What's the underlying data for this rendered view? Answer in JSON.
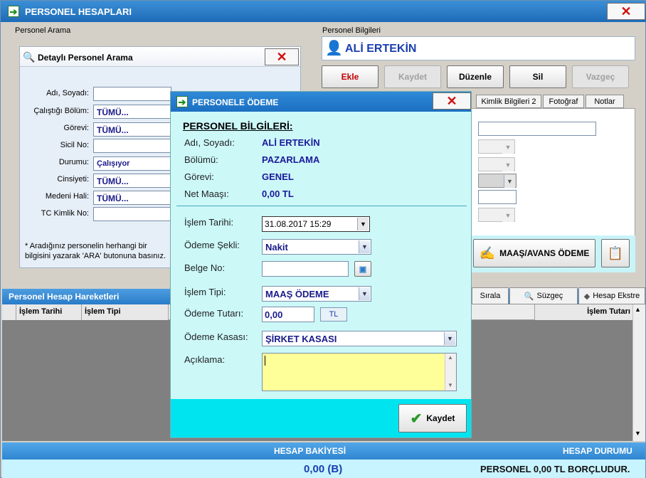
{
  "window": {
    "title": "PERSONEL HESAPLARI"
  },
  "search_panel": {
    "group_label": "Personel Arama",
    "title": "Detaylı Personel Arama",
    "fields": {
      "ad_soyad": {
        "label": "Adı, Soyadı:",
        "value": ""
      },
      "bolum": {
        "label": "Çalıştığı Bölüm:",
        "value": "TÜMÜ..."
      },
      "gorev": {
        "label": "Görevi:",
        "value": "TÜMÜ..."
      },
      "sicil": {
        "label": "Sicil No:",
        "value": ""
      },
      "durum": {
        "label": "Durumu:",
        "value": "Çalışıyor"
      },
      "cinsiyet": {
        "label": "Cinsiyeti:",
        "value": "TÜMÜ..."
      },
      "medeni": {
        "label": "Medeni Hali:",
        "value": "TÜMÜ..."
      },
      "tc": {
        "label": "TC Kimlik No:",
        "value": ""
      }
    },
    "hint": "* Aradığınız personelin herhangi bir bilgisini yazarak 'ARA' butonuna basınız."
  },
  "personel_info": {
    "group_label": "Personel Bilgileri",
    "name": "ALİ ERTEKİN",
    "buttons": {
      "ekle": "Ekle",
      "kaydet": "Kaydet",
      "duzenle": "Düzenle",
      "sil": "Sil",
      "vazgec": "Vazgeç"
    },
    "tabs": [
      "Kimlik Bilgileri 2",
      "Fotoğraf",
      "Notlar"
    ],
    "maas_button": "MAAŞ/AVANS ÖDEME"
  },
  "hareketler": {
    "title": "Personel Hesap Hareketleri",
    "toolbar": {
      "sirala": "Sırala",
      "suzgec": "Süzgeç",
      "ekstre": "Hesap Ekstre"
    },
    "columns": {
      "tarih": "İşlem Tarihi",
      "tip": "İşlem Tipi",
      "tutar": "İşlem Tutarı"
    }
  },
  "footer": {
    "bakiye_label": "HESAP BAKİYESİ",
    "durum_label": "HESAP DURUMU",
    "bakiye_value": "0,00 (B)",
    "durum_value": "PERSONEL 0,00 TL BORÇLUDUR."
  },
  "dialog": {
    "title": "PERSONELE ÖDEME",
    "section": "PERSONEL BİLGİLERİ:",
    "info": {
      "ad_label": "Adı, Soyadı:",
      "ad_value": "ALİ ERTEKİN",
      "bolum_label": "Bölümü:",
      "bolum_value": "PAZARLAMA",
      "gorev_label": "Görevi:",
      "gorev_value": "GENEL",
      "maas_label": "Net Maaşı:",
      "maas_value": "0,00 TL"
    },
    "form": {
      "tarih_label": "İşlem Tarihi:",
      "tarih_value": "31.08.2017 15:29",
      "sekil_label": "Ödeme Şekli:",
      "sekil_value": "Nakit",
      "belge_label": "Belge No:",
      "belge_value": "",
      "tip_label": "İşlem Tipi:",
      "tip_value": "MAAŞ ÖDEME",
      "tutar_label": "Ödeme Tutarı:",
      "tutar_value": "0,00",
      "tutar_unit": "TL",
      "kasa_label": "Ödeme Kasası:",
      "kasa_value": "ŞİRKET KASASI",
      "aciklama_label": "Açıklama:",
      "aciklama_value": ""
    },
    "save_button": "Kaydet"
  },
  "colors": {
    "accent": "#1e6bb8",
    "dialog_bg": "#ccf8f8",
    "dialog_footer": "#00e4f0",
    "note_yellow": "#ffff99"
  }
}
